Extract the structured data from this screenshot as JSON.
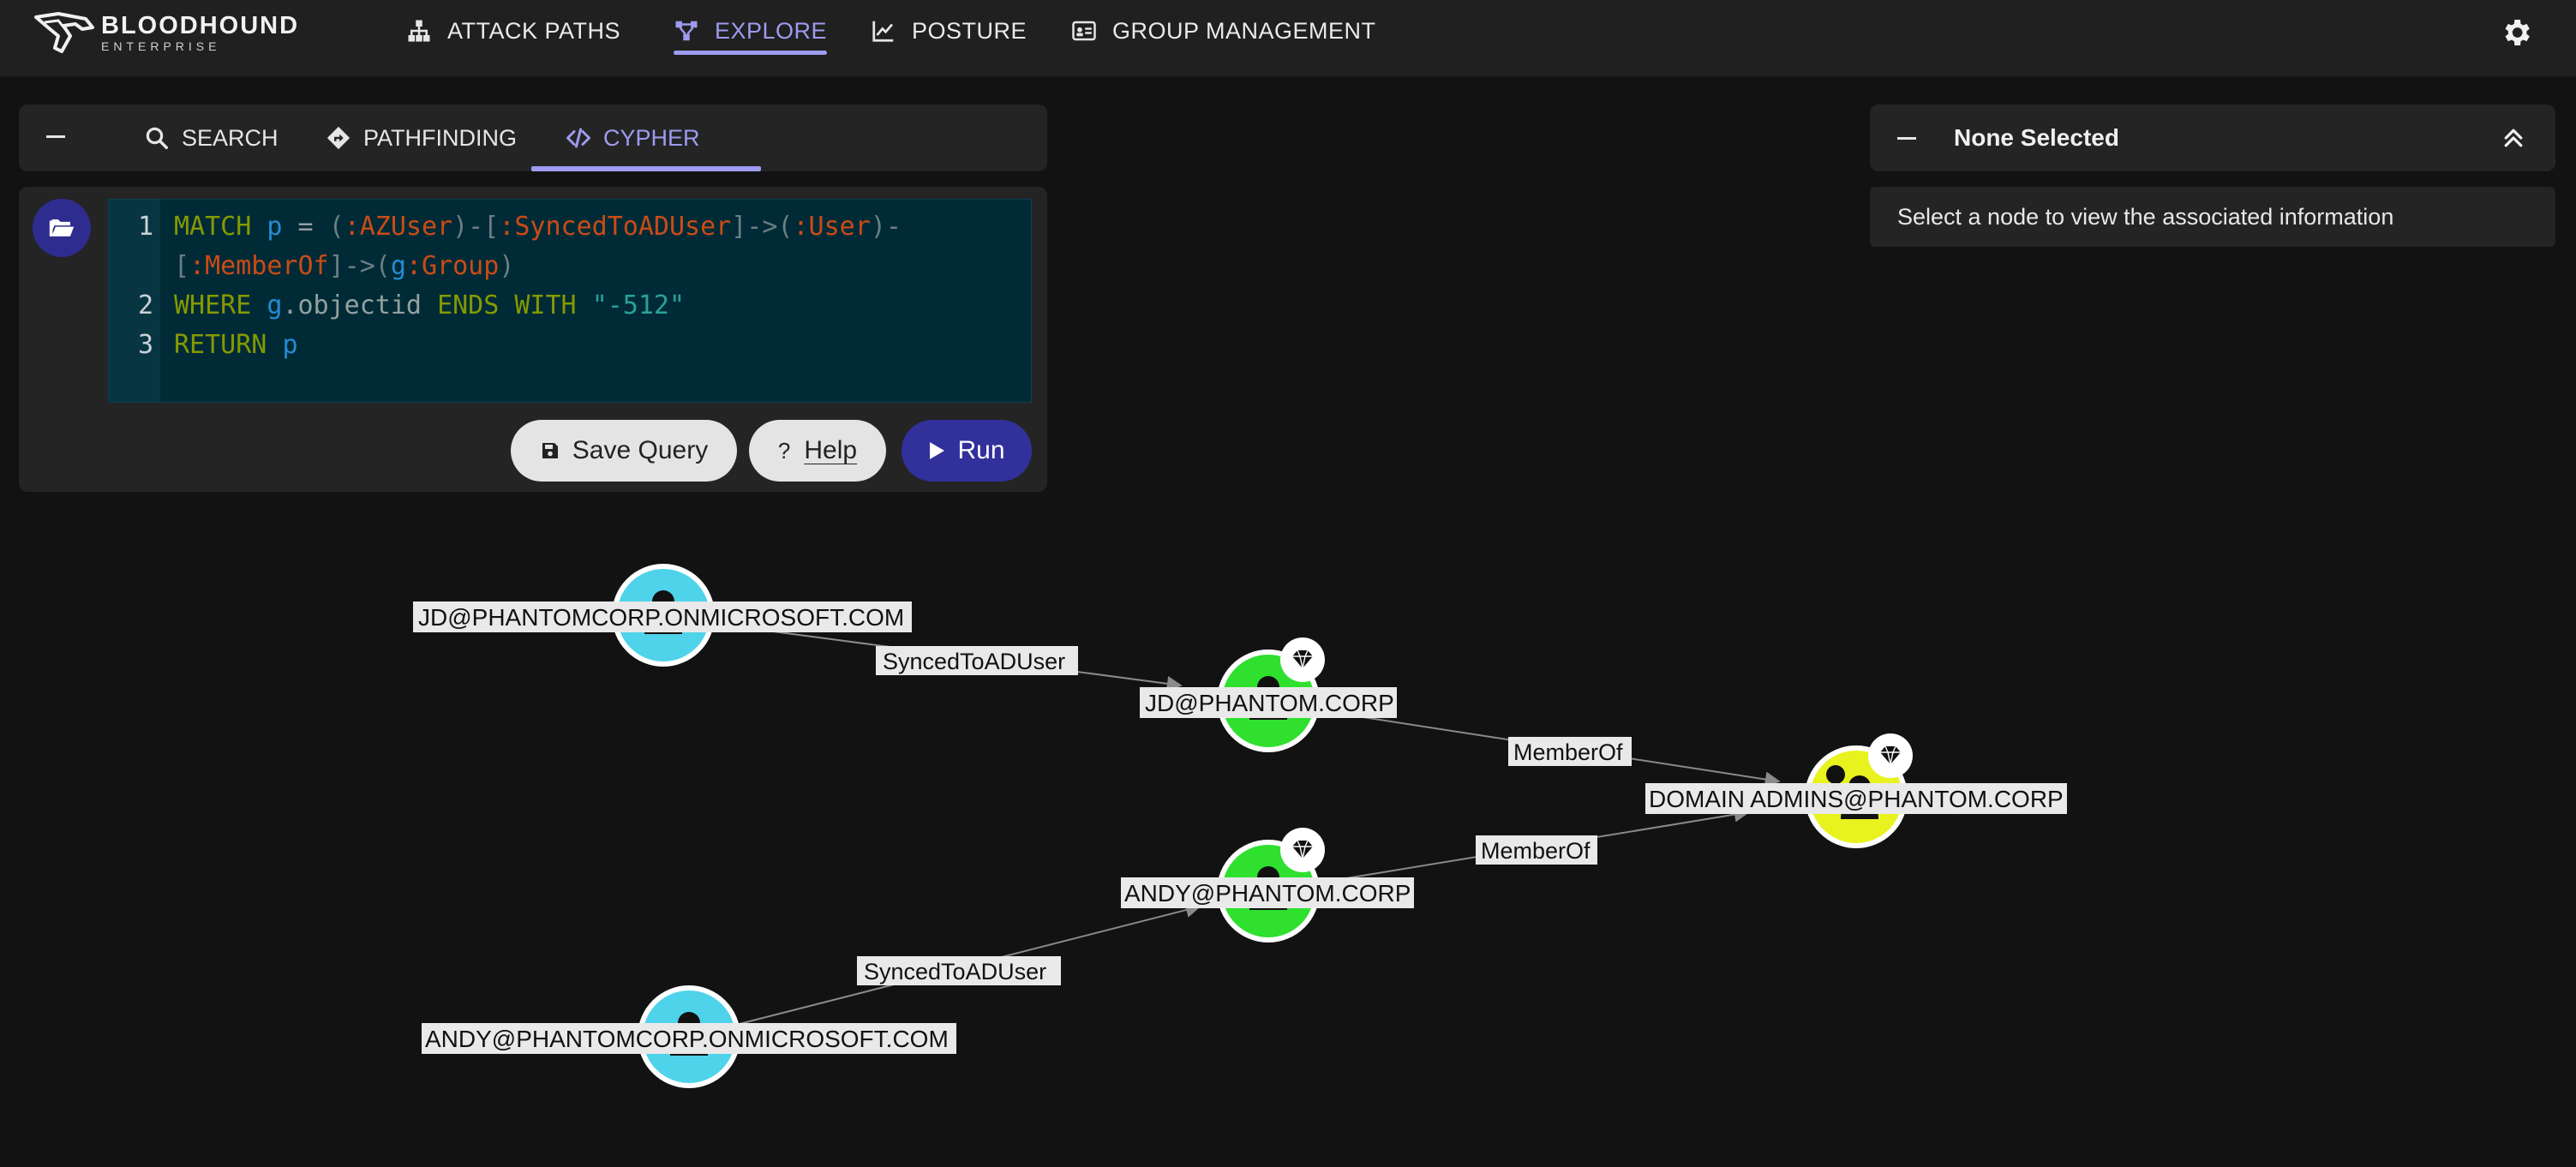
{
  "app": {
    "logo_main": "BLOODHOUND",
    "logo_sub": "ENTERPRISE"
  },
  "nav": {
    "attack_paths": "ATTACK PATHS",
    "explore": "EXPLORE",
    "posture": "POSTURE",
    "group_management": "GROUP MANAGEMENT"
  },
  "search_tabs": {
    "search": "SEARCH",
    "pathfinding": "PATHFINDING",
    "cypher": "CYPHER",
    "active": "cypher"
  },
  "editor": {
    "line_numbers": [
      "1",
      "2",
      "3"
    ],
    "query_lines": [
      "MATCH p = (:AZUser)-[:SyncedToADUser]->(:User)-[:MemberOf]->(g:Group)",
      "WHERE g.objectid ENDS WITH \"-512\"",
      "RETURN p"
    ],
    "tokens": {
      "match": "MATCH",
      "p": "p",
      "eq": "=",
      "azuser": ":AZUser",
      "synced": ":SyncedToADUser",
      "user": ":User",
      "memberof": ":MemberOf",
      "g": "g",
      "group": ":Group",
      "where": "WHERE",
      "objectid": ".objectid",
      "ends_with": "ENDS WITH",
      "suffix": "\"-512\"",
      "return": "RETURN"
    }
  },
  "buttons": {
    "save_query": "Save Query",
    "help": "Help",
    "run": "Run"
  },
  "info_panel": {
    "title": "None Selected",
    "message": "Select a node to view the associated information"
  },
  "graph": {
    "nodes": [
      {
        "id": "jd_az",
        "label": "JD@PHANTOMCORP.ONMICROSOFT.COM",
        "kind": "AZUser",
        "color": "#4fd3ea",
        "highvalue": false
      },
      {
        "id": "jd_ad",
        "label": "JD@PHANTOM.CORP",
        "kind": "User",
        "color": "#2fe02f",
        "highvalue": true
      },
      {
        "id": "da",
        "label": "DOMAIN ADMINS@PHANTOM.CORP",
        "kind": "Group",
        "color": "#e8f21e",
        "highvalue": true
      },
      {
        "id": "andy_ad",
        "label": "ANDY@PHANTOM.CORP",
        "kind": "User",
        "color": "#2fe02f",
        "highvalue": true
      },
      {
        "id": "andy_az",
        "label": "ANDY@PHANTOMCORP.ONMICROSOFT.COM",
        "kind": "AZUser",
        "color": "#4fd3ea",
        "highvalue": false
      }
    ],
    "edges": [
      {
        "from": "jd_az",
        "to": "jd_ad",
        "label": "SyncedToADUser"
      },
      {
        "from": "jd_ad",
        "to": "da",
        "label": "MemberOf"
      },
      {
        "from": "andy_ad",
        "to": "da",
        "label": "MemberOf"
      },
      {
        "from": "andy_az",
        "to": "andy_ad",
        "label": "SyncedToADUser"
      }
    ]
  },
  "colors": {
    "accent": "#9e9bf0",
    "run_button": "#32309b",
    "background": "#121212",
    "panel": "#242424"
  },
  "icons": {
    "logo": "bloodhound-logo-icon",
    "attack_paths": "sitemap-icon",
    "explore": "graph-nodes-icon",
    "posture": "line-chart-icon",
    "group_management": "id-card-icon",
    "settings": "gear-icon",
    "search": "search-icon",
    "pathfinding": "directions-icon",
    "cypher": "code-icon",
    "folder": "folder-open-icon",
    "save": "floppy-disk-icon",
    "help": "question-mark-icon",
    "run": "play-icon",
    "collapse": "chevrons-up-icon",
    "high_value": "gem-icon"
  }
}
